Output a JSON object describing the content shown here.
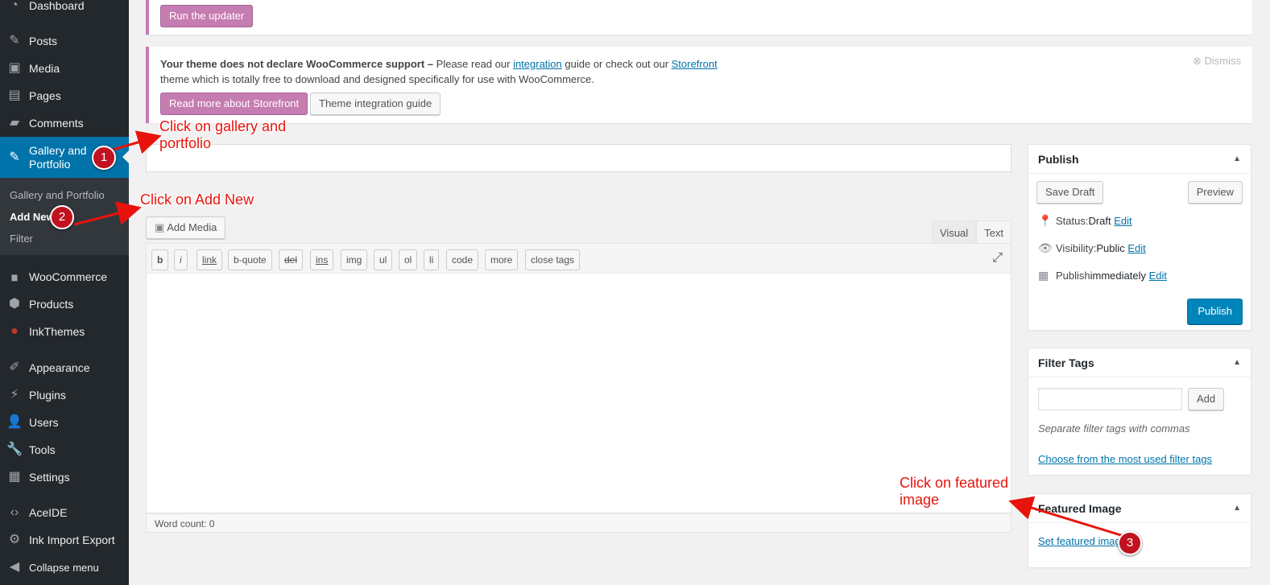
{
  "sidebar": {
    "items": [
      {
        "label": "Dashboard",
        "icon": "dashboard-icon"
      },
      {
        "label": "Posts",
        "icon": "pin-icon"
      },
      {
        "label": "Media",
        "icon": "media-icon"
      },
      {
        "label": "Pages",
        "icon": "pages-icon"
      },
      {
        "label": "Comments",
        "icon": "comment-icon"
      },
      {
        "label": "Gallery and Portfolio",
        "icon": "pin-icon"
      },
      {
        "label": "WooCommerce",
        "icon": "woo-icon"
      },
      {
        "label": "Products",
        "icon": "box-icon"
      },
      {
        "label": "InkThemes",
        "icon": "inkthemes-icon"
      },
      {
        "label": "Appearance",
        "icon": "brush-icon"
      },
      {
        "label": "Plugins",
        "icon": "plug-icon"
      },
      {
        "label": "Users",
        "icon": "user-icon"
      },
      {
        "label": "Tools",
        "icon": "wrench-icon"
      },
      {
        "label": "Settings",
        "icon": "settings-icon"
      },
      {
        "label": "AceIDE",
        "icon": "code-icon"
      },
      {
        "label": "Ink Import Export",
        "icon": "gear-icon"
      },
      {
        "label": "Collapse menu",
        "icon": "collapse-icon"
      }
    ],
    "submenu": [
      "Gallery and Portfolio",
      "Add New",
      "Filter"
    ]
  },
  "notices": {
    "updater_button": "Run the updater",
    "woo_bold": "Your theme does not declare WooCommerce support",
    "woo_dash": " – ",
    "woo_text1": "Please read our ",
    "woo_link1": "integration",
    "woo_text2": " guide or check out our ",
    "woo_link2": "Storefront",
    "woo_text3": "theme which is totally free to download and designed specifically for use with WooCommerce.",
    "dismiss": "Dismiss",
    "read_more_button": "Read more about Storefront",
    "integration_button": "Theme integration guide"
  },
  "editor": {
    "add_media": "Add Media",
    "tabs": [
      "Visual",
      "Text"
    ],
    "quicktags": [
      "b",
      "i",
      "link",
      "b-quote",
      "del",
      "ins",
      "img",
      "ul",
      "ol",
      "li",
      "code",
      "more",
      "close tags"
    ],
    "word_count": "Word count: 0"
  },
  "publish": {
    "title": "Publish",
    "save_draft": "Save Draft",
    "preview": "Preview",
    "status_label": "Status: ",
    "status_value": "Draft",
    "visibility_label": "Visibility: ",
    "visibility_value": "Public",
    "publish_label": "Publish ",
    "publish_value": "immediately",
    "edit": "Edit",
    "publish_button": "Publish"
  },
  "filter_tags": {
    "title": "Filter Tags",
    "add_button": "Add",
    "hint": "Separate filter tags with commas",
    "choose_link": "Choose from the most used filter tags"
  },
  "featured_image": {
    "title": "Featured Image",
    "set_link": "Set featured image"
  },
  "annotations": {
    "step1": "Click on gallery and portfolio",
    "step2": "Click on Add New",
    "step3": "Click on featured image",
    "badge1": "1",
    "badge2": "2",
    "badge3": "3"
  },
  "colors": {
    "sidebar_bg": "#23282d",
    "active_menu": "#0073aa",
    "woo_purple": "#c57cb0",
    "primary_button": "#0085ba",
    "annotation_red": "#e8130c"
  }
}
